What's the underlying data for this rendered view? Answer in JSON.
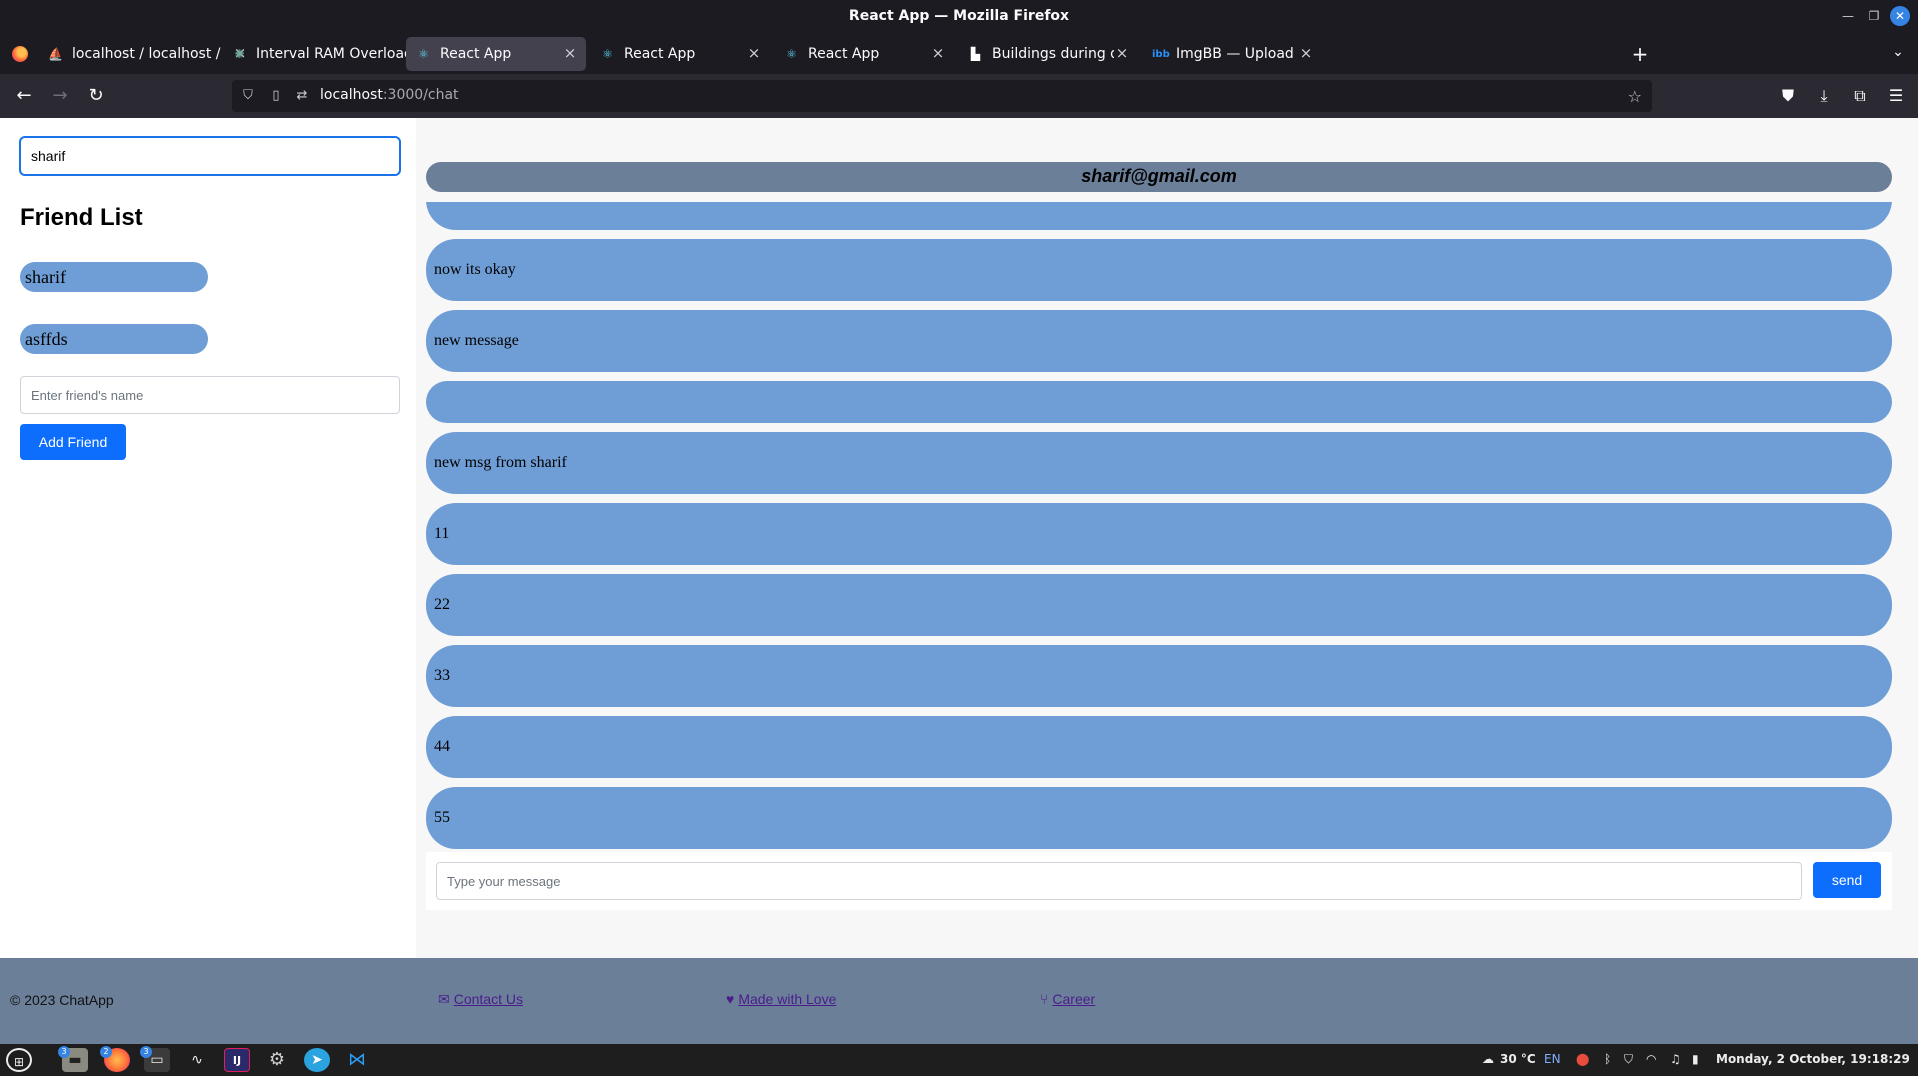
{
  "window": {
    "title": "React App — Mozilla Firefox"
  },
  "tabs": [
    {
      "label": "localhost / localhost / chatA",
      "icon": "phpmyadmin-icon",
      "active": false
    },
    {
      "label": "Interval RAM Overload Fix",
      "icon": "chatgpt-icon",
      "active": false
    },
    {
      "label": "React App",
      "icon": "react-icon",
      "active": true
    },
    {
      "label": "React App",
      "icon": "react-icon",
      "active": false
    },
    {
      "label": "React App",
      "icon": "react-icon",
      "active": false
    },
    {
      "label": "Buildings during day photo",
      "icon": "unsplash-icon",
      "active": false
    },
    {
      "label": "ImgBB — Upload Image — I",
      "icon": "imgbb-icon",
      "active": false
    }
  ],
  "navbar": {
    "url_host": "localhost",
    "url_rest": ":3000/chat"
  },
  "sidebar": {
    "search_value": "sharif",
    "title": "Friend List",
    "friends": [
      "sharif",
      "asffds"
    ],
    "friend_input_placeholder": "Enter friend's name",
    "add_button": "Add Friend"
  },
  "chat": {
    "header": "sharif@gmail.com",
    "messages": [
      "",
      "now its okay",
      "new message",
      "",
      "new msg from sharif",
      "11",
      "22",
      "33",
      "44",
      "55"
    ],
    "input_placeholder": "Type your message",
    "send_button": "send"
  },
  "footer": {
    "copyright": "© 2023 ChatApp",
    "contact": "Contact Us",
    "love": "Made with Love",
    "career": "Career"
  },
  "taskbar": {
    "badges": [
      "3",
      "2",
      "3"
    ],
    "temperature": "30 °C",
    "language": "EN",
    "datetime": "Monday, 2 October, 19:18:29"
  },
  "colors": {
    "message_bubble": "#6f9ed6",
    "header_bar": "#6b7f99",
    "primary_button": "#0d6efd",
    "footer": "#6b7f99"
  }
}
